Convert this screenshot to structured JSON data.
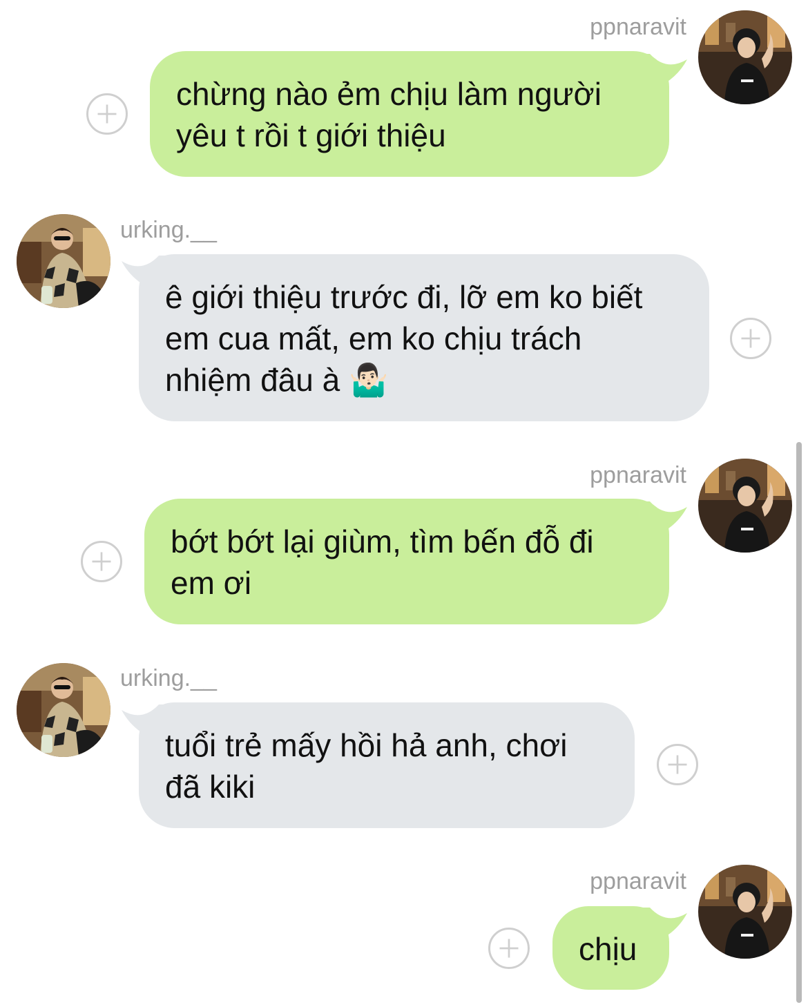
{
  "chat": {
    "messages": [
      {
        "sender": "ppnaravit",
        "side": "right",
        "text": "chừng nào ẻm chịu làm người\nyêu t rồi t giới thiệu"
      },
      {
        "sender": "urking.__",
        "side": "left",
        "text": "ê giới thiệu trước đi, lỡ em ko biết\nem cua mất, em ko chịu trách\nnhiệm đâu à 🤷🏻‍♂️"
      },
      {
        "sender": "ppnaravit",
        "side": "right",
        "text": "bớt bớt lại giùm, tìm bến đỗ đi\nem ơi"
      },
      {
        "sender": "urking.__",
        "side": "left",
        "text": "tuổi trẻ mấy hồi hả anh, chơi\nđã kiki"
      },
      {
        "sender": "ppnaravit",
        "side": "right",
        "text": "chịu"
      }
    ]
  },
  "icons": {
    "react": "add-reaction-icon",
    "avatar_me": "avatar-ppnaravit",
    "avatar_them": "avatar-urking"
  },
  "colors": {
    "bubble_me": "#c9ee9b",
    "bubble_them": "#e4e7ea",
    "sender_name": "#9d9d9d"
  }
}
